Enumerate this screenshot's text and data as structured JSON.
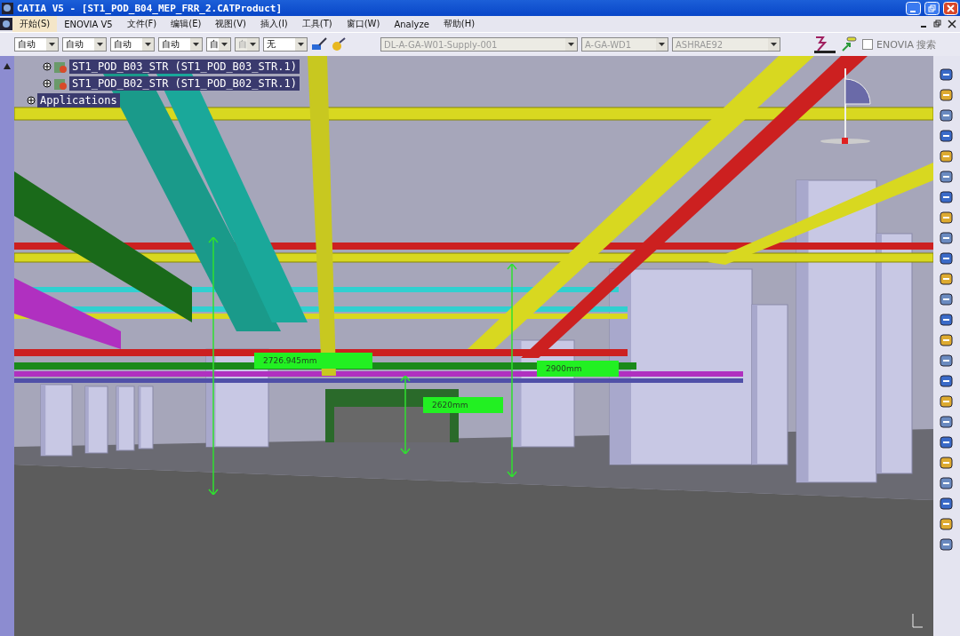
{
  "window": {
    "title": "CATIA V5 - [ST1_POD_B04_MEP_FRR_2.CATProduct]"
  },
  "menu": [
    {
      "label": "开始(S)",
      "selected": true
    },
    {
      "label": "ENOVIA V5",
      "selected": false
    },
    {
      "label": "文件(F)",
      "selected": false
    },
    {
      "label": "编辑(E)",
      "selected": false
    },
    {
      "label": "视图(V)",
      "selected": false
    },
    {
      "label": "插入(I)",
      "selected": false
    },
    {
      "label": "工具(T)",
      "selected": false
    },
    {
      "label": "窗口(W)",
      "selected": false
    },
    {
      "label": "Analyze",
      "selected": false
    },
    {
      "label": "帮助(H)",
      "selected": false
    }
  ],
  "toolbar": {
    "dropdowns": [
      {
        "value": "自动",
        "disabled": false
      },
      {
        "value": "自动",
        "disabled": false
      },
      {
        "value": "自动",
        "disabled": false
      },
      {
        "value": "自动",
        "disabled": false
      },
      {
        "value": "自",
        "disabled": false
      },
      {
        "value": "自",
        "disabled": true
      },
      {
        "value": "无",
        "disabled": false
      }
    ],
    "selects": [
      {
        "value": "DL-A-GA-W01-Supply-001",
        "disabled": true
      },
      {
        "value": "A-GA-WD1",
        "disabled": true
      },
      {
        "value": "ASHRAE92",
        "disabled": true
      }
    ],
    "enovia_search": {
      "label": "ENOVIA 搜索",
      "checked": false
    }
  },
  "tree": [
    {
      "label": "ST1_POD_B03_STR (ST1_POD_B03_STR.1)"
    },
    {
      "label": "ST1_POD_B02_STR (ST1_POD_B02_STR.1)"
    },
    {
      "label": "Applications"
    }
  ],
  "measurements": [
    "2726.945mm",
    "2900mm",
    "2620mm"
  ]
}
